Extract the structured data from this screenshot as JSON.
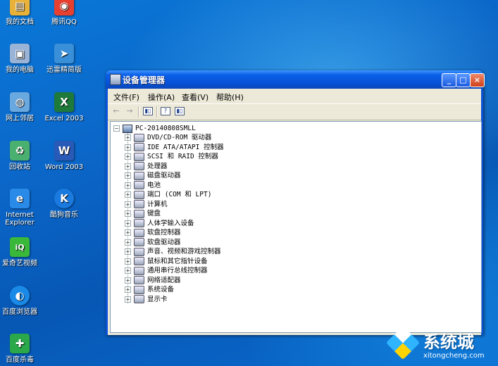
{
  "desktop_icons": [
    {
      "label": "我的文档",
      "icon": "folder-documents-icon",
      "color": "#e8b23a"
    },
    {
      "label": "腾讯QQ",
      "icon": "qq-penguin-icon",
      "color": "#e84030"
    },
    {
      "label": "我的电脑",
      "icon": "my-computer-icon",
      "color": "#9ab4d8"
    },
    {
      "label": "迅雷精简版",
      "icon": "thunder-bird-icon",
      "color": "#3a90d8"
    },
    {
      "label": "网上邻居",
      "icon": "network-neighborhood-icon",
      "color": "#6aa8e0"
    },
    {
      "label": "Excel 2003",
      "icon": "excel-icon",
      "color": "#1e7a3a"
    },
    {
      "label": "回收站",
      "icon": "recycle-bin-icon",
      "color": "#4ab070"
    },
    {
      "label": "Word 2003",
      "icon": "word-icon",
      "color": "#2a5ab8"
    },
    {
      "label": "Internet Explorer",
      "icon": "internet-explorer-icon",
      "color": "#2a8ae8"
    },
    {
      "label": "酷狗音乐",
      "icon": "kugou-music-icon",
      "color": "#1a7ae0"
    },
    {
      "label": "爱奇艺视频",
      "icon": "iqiyi-icon",
      "color": "#3ab83a"
    },
    {
      "label": "百度浏览器",
      "icon": "baidu-browser-icon",
      "color": "#1a8ae8"
    },
    {
      "label": "百度杀毒",
      "icon": "baidu-antivirus-icon",
      "color": "#2aa84a"
    }
  ],
  "icon_glyphs": [
    "▤",
    "◉",
    "▣",
    "➤",
    "◍",
    "X",
    "♻",
    "W",
    "e",
    "K",
    "iQ",
    "◐",
    "✚"
  ],
  "window": {
    "title": "设备管理器",
    "minimize": "_",
    "maximize": "□",
    "close": "×"
  },
  "menu": [
    "文件(F)",
    "操作(A)",
    "查看(V)",
    "帮助(H)"
  ],
  "toolbar_glyphs": {
    "back": "←",
    "forward": "→"
  },
  "tree": {
    "root": "PC-20140808SMLL",
    "expand_glyph": "+",
    "collapse_glyph": "−",
    "nodes": [
      "DVD/CD-ROM 驱动器",
      "IDE ATA/ATAPI 控制器",
      "SCSI 和 RAID 控制器",
      "处理器",
      "磁盘驱动器",
      "电池",
      "端口 (COM 和 LPT)",
      "计算机",
      "键盘",
      "人体学输入设备",
      "软盘控制器",
      "软盘驱动器",
      "声音、视频和游戏控制器",
      "鼠标和其它指针设备",
      "通用串行总线控制器",
      "网络适配器",
      "系统设备",
      "显示卡"
    ]
  },
  "watermark": {
    "name": "系统城",
    "url": "xitongcheng.com"
  }
}
